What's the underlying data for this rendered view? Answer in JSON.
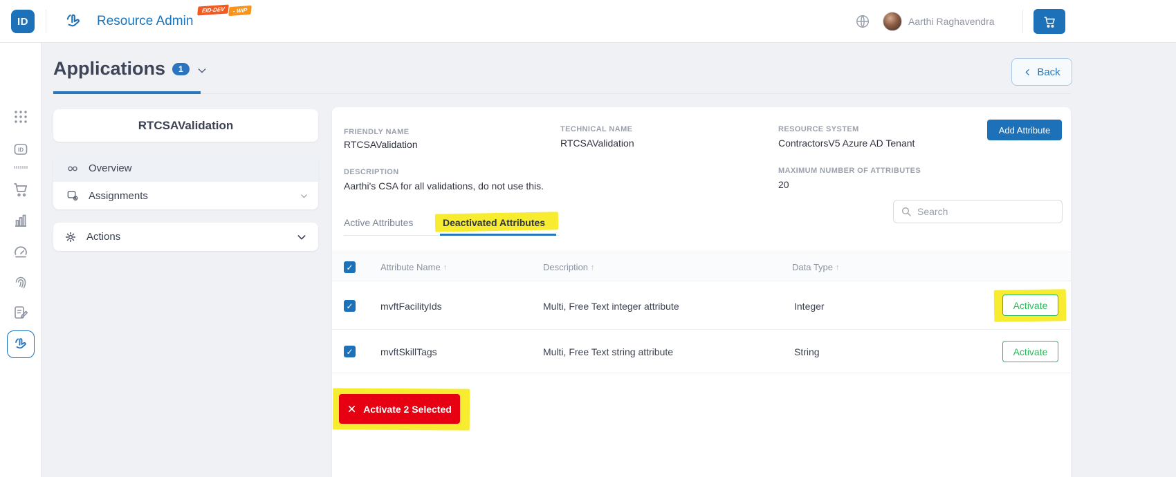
{
  "colors": {
    "accent": "#1d71b8",
    "underline-blue": "#2777bd",
    "green": "#2eb85c",
    "red": "#e60012",
    "highlight": "#f8ec31"
  },
  "icons": {
    "check": "✓",
    "sort": "↑"
  },
  "header": {
    "logo_text": "ID",
    "app_title": "Resource Admin",
    "badges": [
      "EID-DEV",
      "- WIP"
    ],
    "user_name": "Aarthi Raghavendra"
  },
  "page": {
    "title": "Applications",
    "count": "1",
    "back_label": "Back"
  },
  "left_panel": {
    "title": "RTCSAValidation",
    "menu": [
      {
        "label": "Overview",
        "active": true
      },
      {
        "label": "Assignments",
        "active": false
      }
    ],
    "actions_label": "Actions"
  },
  "details": {
    "friendly_name_label": "FRIENDLY NAME",
    "friendly_name": "RTCSAValidation",
    "technical_name_label": "TECHNICAL NAME",
    "technical_name": "RTCSAValidation",
    "resource_system_label": "RESOURCE SYSTEM",
    "resource_system": "ContractorsV5 Azure AD Tenant",
    "description_label": "DESCRIPTION",
    "description": "Aarthi's CSA for all validations, do not use this.",
    "max_attributes_label": "MAXIMUM NUMBER OF ATTRIBUTES",
    "max_attributes": "20",
    "add_attribute_label": "Add Attribute"
  },
  "tabs": [
    {
      "label": "Active Attributes",
      "active": false
    },
    {
      "label": "Deactivated Attributes",
      "active": true
    }
  ],
  "search": {
    "placeholder": "Search"
  },
  "table": {
    "columns": [
      "Attribute Name",
      "Description",
      "Data Type"
    ],
    "rows": [
      {
        "name": "mvftFacilityIds",
        "description": "Multi, Free Text integer attribute",
        "data_type": "Integer",
        "action": "Activate",
        "checked": true,
        "highlighted": true
      },
      {
        "name": "mvftSkillTags",
        "description": "Multi, Free Text string attribute",
        "data_type": "String",
        "action": "Activate",
        "checked": true,
        "highlighted": false
      }
    ]
  },
  "bulk_action": {
    "label": "Activate 2 Selected"
  }
}
